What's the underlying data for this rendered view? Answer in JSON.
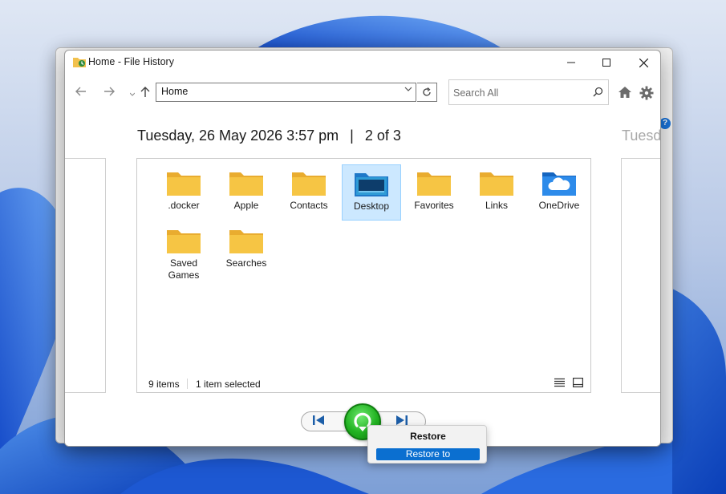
{
  "window": {
    "title": "Home - File History"
  },
  "toolbar": {
    "address": "Home",
    "search_placeholder": "Search All"
  },
  "snapshot": {
    "date": "Tuesday, 26 May 2026 3:57 pm",
    "separator": "|",
    "position": "2 of 3",
    "next_peek": "Tuesday"
  },
  "files": [
    {
      "label": "​.docker",
      "type": "folder"
    },
    {
      "label": "Apple",
      "type": "folder"
    },
    {
      "label": "Contacts",
      "type": "folder"
    },
    {
      "label": "Desktop",
      "type": "desktop-folder",
      "selected": true
    },
    {
      "label": "Favorites",
      "type": "folder"
    },
    {
      "label": "Links",
      "type": "folder"
    },
    {
      "label": "OneDrive",
      "type": "onedrive-folder"
    },
    {
      "label": "Saved Games",
      "type": "folder"
    },
    {
      "label": "Searches",
      "type": "folder"
    }
  ],
  "status": {
    "items": "9 items",
    "selected": "1 item selected"
  },
  "context_menu": {
    "restore": "Restore",
    "restore_to": "Restore to"
  },
  "colors": {
    "folder": "#f6c544",
    "selection": "#cce8ff",
    "restore_green": "#22b322",
    "menu_highlight": "#0b6fd0"
  }
}
